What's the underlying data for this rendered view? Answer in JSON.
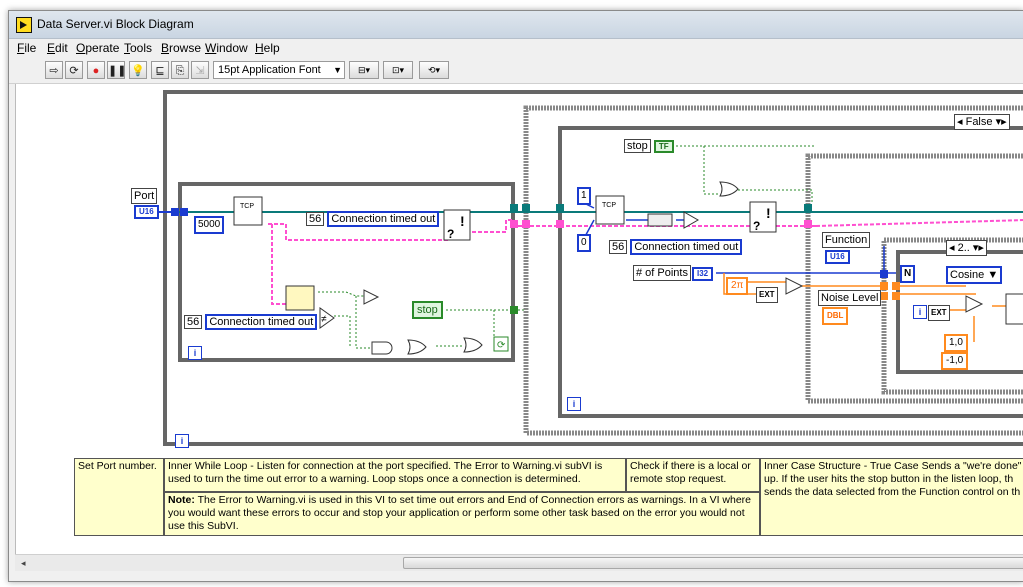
{
  "window": {
    "title": "Data Server.vi Block Diagram"
  },
  "menu": [
    {
      "label": "File",
      "key": "F",
      "rest": "ile"
    },
    {
      "label": "Edit",
      "key": "E",
      "rest": "dit"
    },
    {
      "label": "Operate",
      "key": "O",
      "rest": "perate"
    },
    {
      "label": "Tools",
      "key": "T",
      "rest": "ools"
    },
    {
      "label": "Browse",
      "key": "B",
      "rest": "rowse"
    },
    {
      "label": "Window",
      "key": "W",
      "rest": "indow"
    },
    {
      "label": "Help",
      "key": "H",
      "rest": "elp"
    }
  ],
  "toolbar": {
    "font": "15pt Application Font"
  },
  "diagram": {
    "port_label": "Port",
    "u16": "U16",
    "timeout_const": "5000",
    "err_code_a": "56",
    "err_text_a": "Connection timed out",
    "err_code_b": "56",
    "err_text_b": "Connection timed out",
    "err_code_c": "56",
    "err_text_c": "Connection timed out",
    "stop_label": "stop",
    "stop_local": "stop",
    "tf": "TF",
    "case_false": "False",
    "const_1": "1",
    "const_0": "0",
    "num_points": "# of Points",
    "i32": "I32",
    "two_pi": "2π",
    "ext": "EXT",
    "noise_level": "Noise Level",
    "dbl": "DBL",
    "function_label": "Function",
    "function_u16": "U16",
    "n_term": "N",
    "inner_case": "2..",
    "cosine": "Cosine",
    "ext2": "EXT",
    "c_pos": "1,0",
    "c_neg": "-1,0",
    "iter": "i"
  },
  "notes": {
    "set_port": "Set Port number.",
    "inner_while": "Inner While Loop - Listen for connection at the port specified.  The Error to Warning.vi subVI is used to turn the time out error to a warning.  Loop stops once a connection is determined.",
    "check_stop": "Check if there is a local or remote stop request.",
    "inner_case": "Inner Case Structure - True Case Sends a \"we're done\" i up.  If the user hits the stop button in the listen loop, th sends the data selected from the Function control on th",
    "note_bold": "Note:",
    "note_text": " The Error to Warning.vi is used in this VI to set time out errors and End of Connection errors as warnings.  In a VI where you would want these errors to occur and stop your application or perform some other task based on the error you would not use this SubVI."
  },
  "colors": {
    "wire_int": "#1a3bd0",
    "wire_err": "#e8c838",
    "wire_tcp": "#0a7a7a",
    "wire_str": "#ff4fd0",
    "wire_bool": "#2a8a2a",
    "wire_dbl": "#ff8a1e"
  }
}
